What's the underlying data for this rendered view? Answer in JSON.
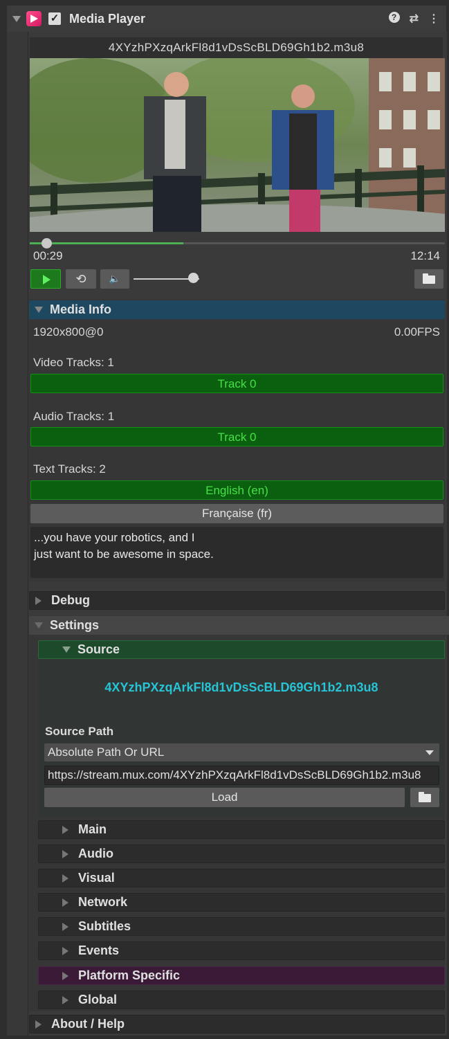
{
  "header": {
    "title": "Media Player",
    "help_icon": "?",
    "settings_icon": "⇄",
    "menu_icon": "⋮"
  },
  "player": {
    "filename": "4XYzhPXzqArkFl8d1vDsScBLD69Gh1b2.m3u8",
    "current_time": "00:29",
    "duration": "12:14",
    "playback_progress": 0.04,
    "buffered_progress": 0.37,
    "volume": 0.9
  },
  "media_info": {
    "title": "Media Info",
    "resolution": "1920x800@0",
    "fps": "0.00FPS",
    "video_tracks_label": "Video Tracks: 1",
    "video_tracks": [
      "Track 0"
    ],
    "audio_tracks_label": "Audio Tracks: 1",
    "audio_tracks": [
      "Track 0"
    ],
    "text_tracks_label": "Text Tracks: 2",
    "text_tracks": [
      "English (en)",
      "Française (fr)"
    ],
    "subtitle_line1": "...you have your robotics, and I",
    "subtitle_line2": "just want to be awesome in space."
  },
  "sections": {
    "debug": "Debug",
    "settings": "Settings",
    "about": "About / Help"
  },
  "source": {
    "title": "Source",
    "url_display": "4XYzhPXzqArkFl8d1vDsScBLD69Gh1b2.m3u8",
    "path_label": "Source Path",
    "path_type": "Absolute Path Or URL",
    "path_value": "https://stream.mux.com/4XYzhPXzqArkFl8d1vDsScBLD69Gh1b2.m3u8",
    "load_label": "Load"
  },
  "settings_sections": [
    "Main",
    "Audio",
    "Visual",
    "Network",
    "Subtitles",
    "Events",
    "Platform Specific",
    "Global"
  ],
  "colors": {
    "accent_green": "#46e046",
    "media_info_header": "#1e4860",
    "source_url": "#27c4d6"
  }
}
